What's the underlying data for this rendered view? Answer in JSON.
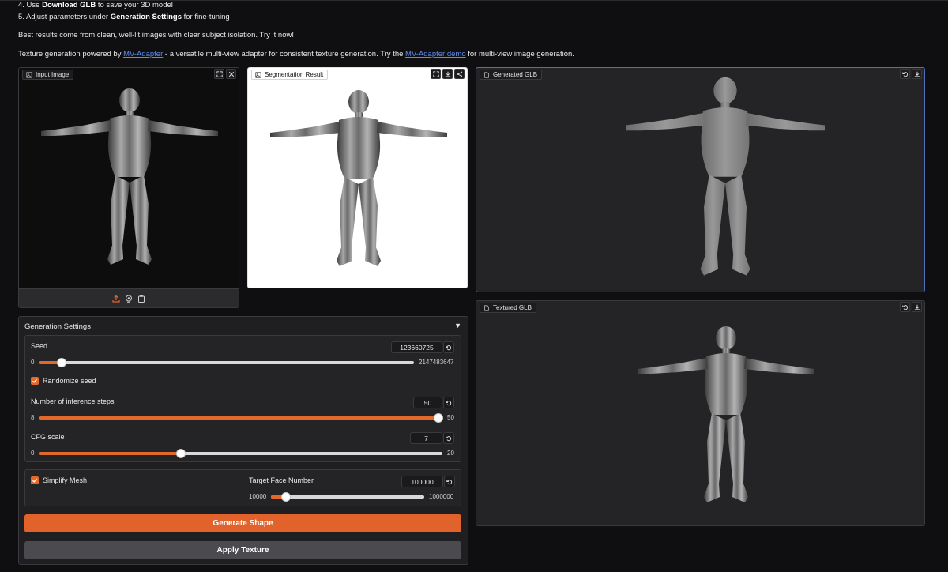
{
  "instructions": {
    "step4_pre": "4. Use ",
    "step4_bold": "Download GLB",
    "step4_post": " to save your 3D model",
    "step5_pre": "5. Adjust parameters under ",
    "step5_bold": "Generation Settings",
    "step5_post": " for fine-tuning",
    "best_results": "Best results come from clean, well-lit images with clear subject isolation. Try it now!",
    "texture_pre": "Texture generation powered by ",
    "texture_link1": "MV-Adapter",
    "texture_mid": " - a versatile multi-view adapter for consistent texture generation. Try the ",
    "texture_link2": "MV-Adapter demo",
    "texture_post": " for multi-view image generation."
  },
  "panels": {
    "input_image": "Input Image",
    "segmentation": "Segmentation Result",
    "generated_glb": "Generated GLB",
    "textured_glb": "Textured GLB"
  },
  "settings": {
    "title": "Generation Settings",
    "seed": {
      "label": "Seed",
      "value": "123660725",
      "min": "0",
      "max": "2147483647",
      "fraction": 0.06
    },
    "randomize_seed": {
      "label": "Randomize seed",
      "checked": true
    },
    "steps": {
      "label": "Number of inference steps",
      "value": "50",
      "min": "8",
      "max": "50",
      "fraction": 1.0
    },
    "cfg": {
      "label": "CFG scale",
      "value": "7",
      "min": "0",
      "max": "20",
      "fraction": 0.35
    },
    "simplify_mesh": {
      "label": "Simplify Mesh",
      "checked": true
    },
    "target_face": {
      "label": "Target Face Number",
      "value": "100000",
      "min": "10000",
      "max": "1000000",
      "fraction": 0.1
    }
  },
  "buttons": {
    "generate_shape": "Generate Shape",
    "apply_texture": "Apply Texture"
  },
  "colors": {
    "accent": "#e1622a",
    "link": "#5b8def",
    "background": "#0f0f11"
  }
}
